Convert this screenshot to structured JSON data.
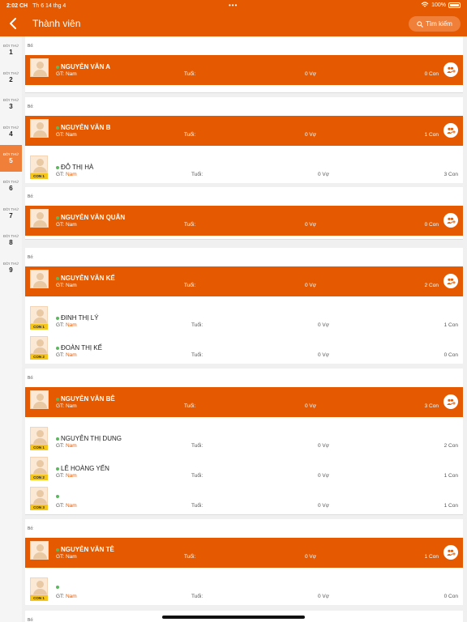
{
  "status": {
    "time": "2:02 CH",
    "date": "Th 6 14 thg 4",
    "battery": "100%"
  },
  "header": {
    "title": "Thành viên",
    "search_label": "Tìm kiếm"
  },
  "sidebar": {
    "label": "ĐỜI THỨ",
    "generations": [
      "1",
      "2",
      "3",
      "4",
      "5",
      "6",
      "7",
      "8",
      "9"
    ],
    "active": "5"
  },
  "labels": {
    "father": "Bố:",
    "gender": "GT:",
    "age": "Tuổi:",
    "wife_suffix": "Vợ",
    "child_suffix": "Con"
  },
  "families": [
    {
      "parent": {
        "name": "NGUYỄN VĂN A",
        "gender": "Nam",
        "wives": "0 Vợ",
        "children": "0 Con"
      },
      "children": []
    },
    {
      "parent": {
        "name": "NGUYỄN VĂN B",
        "gender": "Nam",
        "wives": "0 Vợ",
        "children": "1 Con"
      },
      "children": [
        {
          "badge": "CON 1",
          "name": "ĐỖ THỊ HÀ",
          "gender": "Nam",
          "wives": "0 Vợ",
          "children": "3 Con"
        }
      ]
    },
    {
      "parent": {
        "name": "NGUYỄN VĂN QUÂN",
        "gender": "Nam",
        "wives": "0 Vợ",
        "children": "0 Con"
      },
      "children": []
    },
    {
      "parent": {
        "name": "NGUYỄN VĂN KẾ",
        "gender": "Nam",
        "wives": "0 Vợ",
        "children": "2 Con"
      },
      "children": [
        {
          "badge": "CON 1",
          "name": "ĐINH THỊ LÝ",
          "gender": "Nam",
          "wives": "0 Vợ",
          "children": "1 Con"
        },
        {
          "badge": "CON 2",
          "name": "ĐOÀN THỊ KẾ",
          "gender": "Nam",
          "wives": "0 Vợ",
          "children": "0 Con"
        }
      ]
    },
    {
      "parent": {
        "name": "NGUYỄN VĂN BÊ",
        "gender": "Nam",
        "wives": "0 Vợ",
        "children": "3 Con"
      },
      "children": [
        {
          "badge": "CON 1",
          "name": "NGUYỄN THỊ DUNG",
          "gender": "Nam",
          "wives": "0 Vợ",
          "children": "2 Con"
        },
        {
          "badge": "CON 2",
          "name": "LÊ HOÀNG YẾN",
          "gender": "Nam",
          "wives": "0 Vợ",
          "children": "1 Con"
        },
        {
          "badge": "CON 3",
          "name": "",
          "gender": "Nam",
          "wives": "0 Vợ",
          "children": "1 Con"
        }
      ]
    },
    {
      "parent": {
        "name": "NGUYỄN VĂN TÊ",
        "gender": "Nam",
        "wives": "0 Vợ",
        "children": "1 Con"
      },
      "children": [
        {
          "badge": "CON 1",
          "name": "",
          "gender": "Nam",
          "wives": "0 Vợ",
          "children": "0 Con"
        }
      ]
    }
  ],
  "colors": {
    "primary": "#e55a00",
    "active_tab": "#f07f3a",
    "badge": "#f5c518",
    "online": "#5cb85c"
  }
}
